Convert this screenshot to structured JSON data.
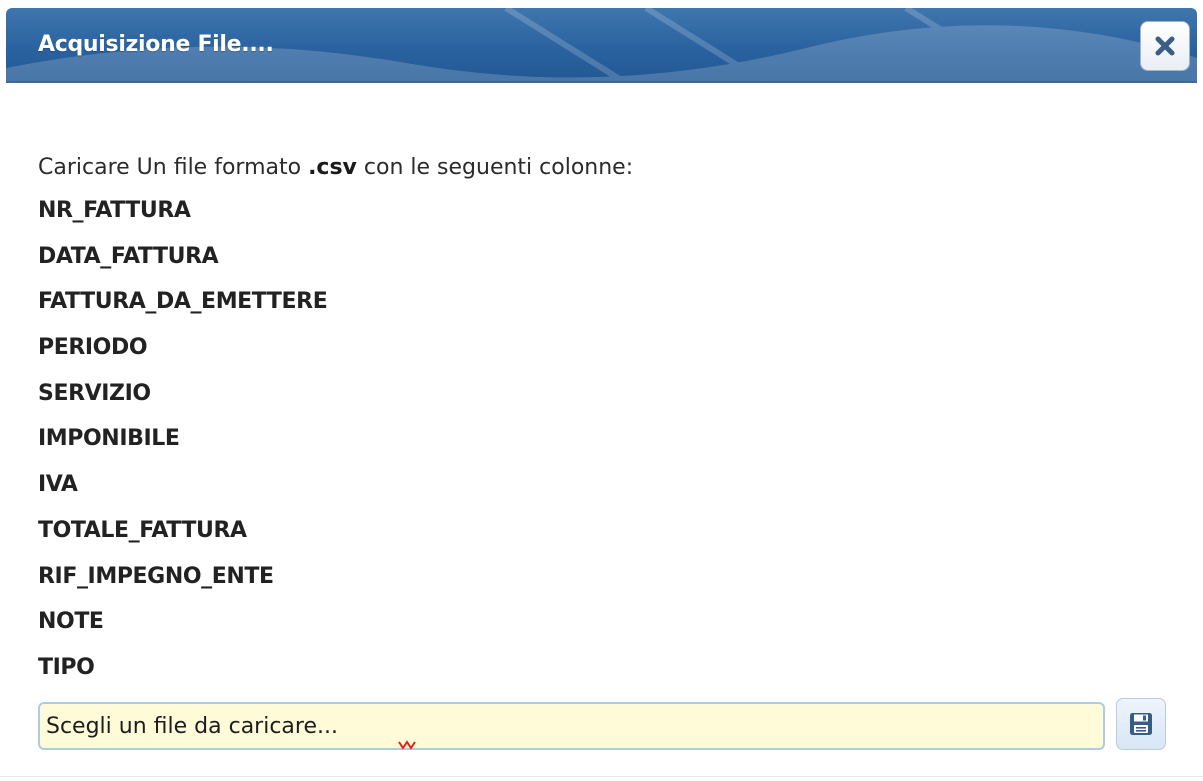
{
  "dialog": {
    "title": "Acquisizione File....",
    "close_icon": "close-icon",
    "accent_color": "#2a62a0"
  },
  "instructions": {
    "text_before": "Caricare Un file formato ",
    "extension": ".csv",
    "text_after": " con le seguenti colonne:"
  },
  "columns": [
    "NR_FATTURA",
    "DATA_FATTURA",
    "FATTURA_DA_EMETTERE",
    "PERIODO",
    "SERVIZIO",
    "IMPONIBILE",
    "IVA",
    "TOTALE_FATTURA",
    "RIF_IMPEGNO_ENTE",
    "NOTE",
    "TIPO"
  ],
  "file_input": {
    "placeholder": "Scegli un file da caricare...",
    "background_color": "#fffbd9"
  },
  "save": {
    "icon": "floppy-disk-icon"
  }
}
